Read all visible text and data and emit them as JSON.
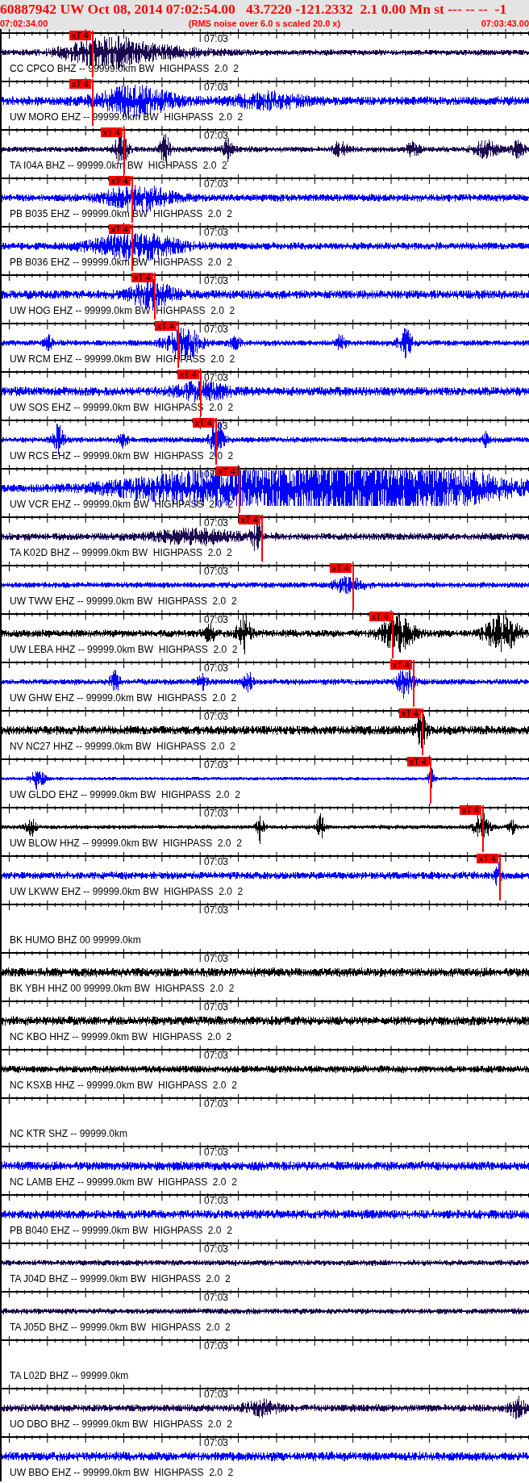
{
  "header": {
    "title": "60887942 UW Oct 08, 2014 07:02:54.00   43.7220 -121.2332  2.1 0.00 Mn st --- -- --  -1",
    "start_time": "07:02:34.00",
    "note": "(RMS noise over 6.0 s scaled 20.0 x)",
    "end_time": "07:03:43.00"
  },
  "traces": [
    {
      "kind": "waveform",
      "color": "#1c0a50",
      "time_label": "07:03",
      "label": "CC CPCO BHZ -- 99999.0km BW  HIGHPASS  2.0  2",
      "pick": "xT 4"
    },
    {
      "kind": "waveform",
      "color": "#0000ff",
      "time_label": "07:03",
      "label": "UW MORO EHZ -- 99999.0km BW  HIGHPASS  2.0  2",
      "pick": "xT 4"
    },
    {
      "kind": "waveform",
      "color": "#1c0a50",
      "time_label": "07:03",
      "label": "TA I04A BHZ -- 99999.0km BW  HIGHPASS  2.0  2",
      "pick": "xT 4"
    },
    {
      "kind": "waveform",
      "color": "#0000ff",
      "time_label": "07:03",
      "label": "PB B035 EHZ -- 99999.0km BW  HIGHPASS  2.0  2",
      "pick": "xT 4"
    },
    {
      "kind": "waveform",
      "color": "#0000ff",
      "time_label": "07:03",
      "label": "PB B036 EHZ -- 99999.0km BW  HIGHPASS  2.0  2",
      "pick": "xT 4"
    },
    {
      "kind": "waveform",
      "color": "#0000ff",
      "time_label": "07:03",
      "label": "UW HOG EHZ -- 99999.0km BW  HIGHPASS  2.0  2",
      "pick": "xT 4"
    },
    {
      "kind": "waveform",
      "color": "#0000ff",
      "time_label": "07:03",
      "label": "UW RCM EHZ -- 99999.0km BW  HIGHPASS  2.0  2",
      "pick": "xT 4"
    },
    {
      "kind": "waveform",
      "color": "#0000ff",
      "time_label": "07:03",
      "label": "UW SOS EHZ -- 99999.0km BW  HIGHPASS  2.0  2",
      "pick": "xT 4"
    },
    {
      "kind": "waveform",
      "color": "#0000ff",
      "time_label": "03",
      "label": "UW RCS EHZ -- 99999.0km BW  HIGHPASS  2.0  2",
      "pick": "xT 4"
    },
    {
      "kind": "waveform",
      "color": "#0000ff",
      "time_label": "07:",
      "label": "UW VCR EHZ -- 99999.0km BW  HIGHPASS  2.0  2",
      "pick": "xT 4"
    },
    {
      "kind": "waveform",
      "color": "#1c0a50",
      "time_label": "07:03",
      "label": "TA K02D BHZ -- 99999.0km BW  HIGHPASS  2.0  2",
      "pick": "xT 4"
    },
    {
      "kind": "waveform",
      "color": "#0000ff",
      "time_label": "07:03",
      "label": "UW TWW EHZ -- 99999.0km BW  HIGHPASS  2.0  2",
      "pick": "xT 4"
    },
    {
      "kind": "waveform",
      "color": "#000000",
      "time_label": "07:03",
      "label": "UW LEBA HHZ -- 99999.0km BW  HIGHPASS  2.0  2",
      "pick": "xT 4"
    },
    {
      "kind": "waveform",
      "color": "#0000ff",
      "time_label": "07:03",
      "label": "UW GHW EHZ -- 99999.0km BW  HIGHPASS  2.0  2",
      "pick": "xT 4"
    },
    {
      "kind": "waveform",
      "color": "#000000",
      "time_label": "07:03",
      "label": "NV NC27 HHZ -- 99999.0km BW  HIGHPASS  2.0  2",
      "pick": "xT 4"
    },
    {
      "kind": "waveform",
      "color": "#0000ff",
      "time_label": "07:03",
      "label": "UW GLDO EHZ -- 99999.0km BW  HIGHPASS  2.0  2",
      "pick": "xT 4"
    },
    {
      "kind": "waveform",
      "color": "#000000",
      "time_label": "07:03",
      "label": "UW BLOW HHZ -- 99999.0km BW  HIGHPASS  2.0  2",
      "pick": "xT 4"
    },
    {
      "kind": "waveform",
      "color": "#0000ff",
      "time_label": "07:03",
      "label": "UW LKWW EHZ -- 99999.0km BW  HIGHPASS  2.0  2",
      "pick": "xT 4"
    },
    {
      "kind": "empty",
      "time_label": "07:03",
      "label": "BK HUMO BHZ 00 99999.0km"
    },
    {
      "kind": "waveform",
      "color": "#000000",
      "time_label": "07:03",
      "label": "BK YBH HHZ 00 99999.0km BW  HIGHPASS  2.0  2"
    },
    {
      "kind": "waveform",
      "color": "#000000",
      "time_label": "07:03",
      "label": "NC KBO HHZ -- 99999.0km BW  HIGHPASS  2.0  2"
    },
    {
      "kind": "waveform",
      "color": "#000000",
      "time_label": "07:03",
      "label": "NC KSXB HHZ -- 99999.0km BW  HIGHPASS  2.0  2"
    },
    {
      "kind": "empty",
      "time_label": "07:03",
      "label": "NC KTR SHZ -- 99999.0km"
    },
    {
      "kind": "waveform",
      "color": "#0000ff",
      "time_label": "07:03",
      "label": "NC LAMB EHZ -- 99999.0km BW  HIGHPASS  2.0  2"
    },
    {
      "kind": "waveform",
      "color": "#0000ff",
      "time_label": "07:03",
      "label": "PB B040 EHZ -- 99999.0km BW  HIGHPASS  2.0  2"
    },
    {
      "kind": "waveform",
      "color": "#1c0a50",
      "time_label": "07:03",
      "label": "TA J04D BHZ -- 99999.0km BW  HIGHPASS  2.0  2"
    },
    {
      "kind": "waveform",
      "color": "#1c0a50",
      "time_label": "07:03",
      "label": "TA J05D BHZ -- 99999.0km BW  HIGHPASS  2.0  2"
    },
    {
      "kind": "empty",
      "time_label": "07:03",
      "label": "TA L02D BHZ -- 99999.0km"
    },
    {
      "kind": "waveform",
      "color": "#1c0a50",
      "time_label": "07:03",
      "label": "UO DBO BHZ -- 99999.0km BW  HIGHPASS  2.0  2"
    },
    {
      "kind": "waveform",
      "color": "#0000ff",
      "time_label": "07:03",
      "label": "UW BBO EHZ -- 99999.0km BW  HIGHPASS  2.0  2"
    }
  ]
}
